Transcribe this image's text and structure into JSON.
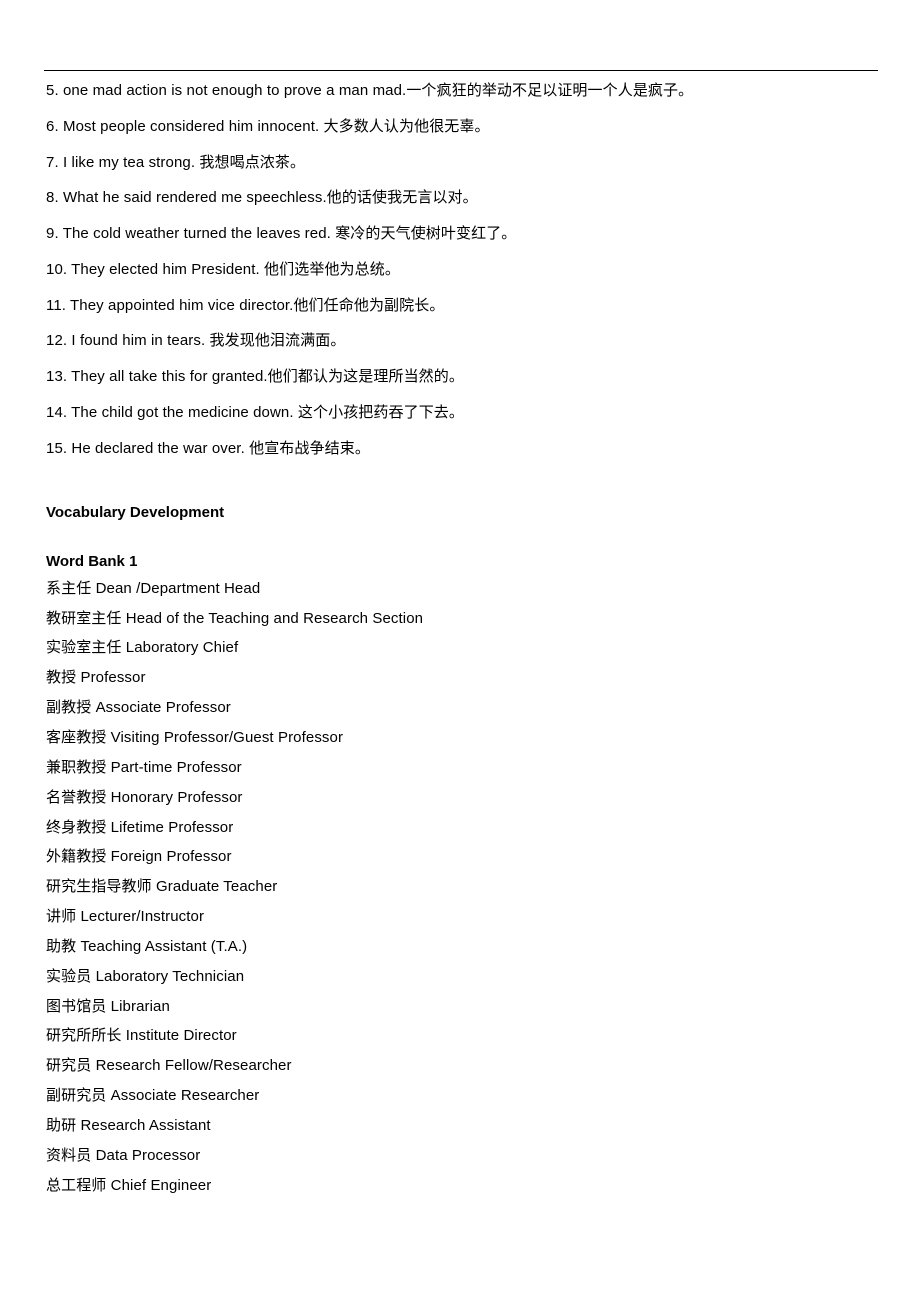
{
  "sentences": [
    "5. one mad action is not enough to prove a man mad.一个疯狂的举动不足以证明一个人是疯子。",
    "6. Most people considered him innocent. 大多数人认为他很无辜。",
    "7. I like my tea strong. 我想喝点浓茶。",
    "8. What he said rendered me speechless.他的话使我无言以对。",
    "9. The cold weather turned the leaves red. 寒冷的天气使树叶变红了。",
    "10. They elected him President. 他们选举他为总统。",
    "11. They appointed him vice director.他们任命他为副院长。",
    "12. I found him in tears. 我发现他泪流满面。",
    "13. They all take this for granted.他们都认为这是理所当然的。",
    "14.  The child got the medicine down. 这个小孩把药吞了下去。",
    "15. He declared the war over. 他宣布战争结束。"
  ],
  "heading1": "Vocabulary Development",
  "heading2": "Word Bank 1",
  "vocab": [
    "系主任 Dean /Department Head",
    "教研室主任 Head of the Teaching and Research Section",
    "实验室主任 Laboratory Chief",
    "教授 Professor",
    "副教授 Associate Professor",
    "客座教授 Visiting Professor/Guest Professor",
    "兼职教授 Part-time Professor",
    "名誉教授 Honorary Professor",
    "终身教授 Lifetime Professor",
    "外籍教授 Foreign Professor",
    "研究生指导教师 Graduate Teacher",
    "讲师 Lecturer/Instructor",
    "助教 Teaching Assistant (T.A.)",
    "实验员 Laboratory Technician",
    "图书馆员 Librarian",
    "研究所所长 Institute Director",
    "研究员 Research Fellow/Researcher",
    "副研究员 Associate Researcher",
    "助研 Research Assistant",
    "资料员 Data Processor",
    "总工程师 Chief Engineer"
  ]
}
